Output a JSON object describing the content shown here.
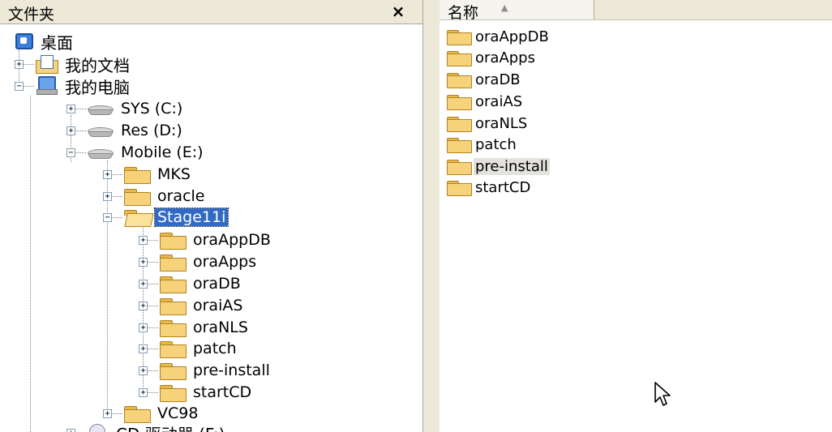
{
  "folder_pane": {
    "title": "文件夹",
    "close_glyph": "×"
  },
  "tree": {
    "desktop": "桌面",
    "my_documents": "我的文档",
    "my_computer": "我的电脑",
    "drives": [
      "SYS (C:)",
      "Res (D:)",
      "Mobile (E:)"
    ],
    "mobile_children": [
      "MKS",
      "oracle",
      "Stage11i"
    ],
    "stage_children": [
      "oraAppDB",
      "oraApps",
      "oraDB",
      "oraiAS",
      "oraNLS",
      "patch",
      "pre-install",
      "startCD"
    ],
    "vc98": "VC98",
    "cd_drive": "CD 驱动器 (F:)"
  },
  "list_pane": {
    "column_header": "名称",
    "sort_icon": "sort-ascending-icon",
    "items": [
      "oraAppDB",
      "oraApps",
      "oraDB",
      "oraiAS",
      "oraNLS",
      "patch",
      "pre-install",
      "startCD"
    ],
    "hovered_item": "pre-install"
  },
  "colors": {
    "selection": "#316ac5",
    "pane_header": "#ece9d8",
    "folder": "#f6d37a"
  }
}
